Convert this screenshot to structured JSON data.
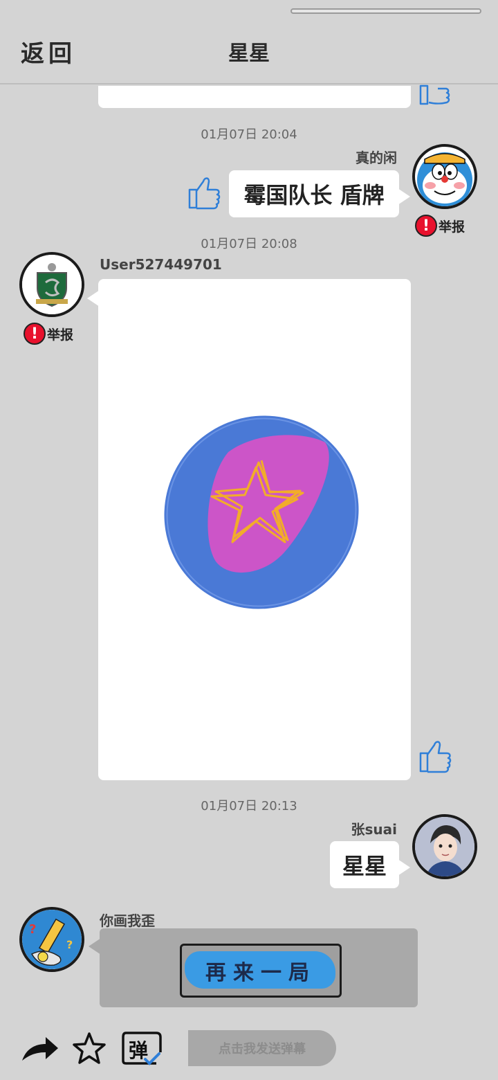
{
  "header": {
    "back_label": "返回",
    "title": "星星"
  },
  "messages": [
    {
      "timestamp": "01月07日  20:04"
    },
    {
      "username": "真的闲",
      "text": "霉国队长 盾牌",
      "report_label": "举报"
    },
    {
      "timestamp": "01月07日  20:08"
    },
    {
      "username": "User527449701",
      "report_label": "举报",
      "drawing": "star-shield-drawing"
    },
    {
      "timestamp": "01月07日  20:13"
    },
    {
      "username": "张suai",
      "text": "星星"
    },
    {
      "username": "你画我歪",
      "button_label": "再来一局"
    }
  ],
  "toolbar": {
    "danmu_placeholder": "点击我发送弹幕",
    "danmu_icon_label": "弹"
  },
  "icons": [
    "share-icon",
    "star-icon",
    "danmu-icon",
    "thumbs-up-icon",
    "report-icon"
  ],
  "colors": {
    "background": "#d4d4d4",
    "report_red": "#e8112d",
    "button_blue": "#3a9be4",
    "thumb_blue": "#2f7fd8"
  }
}
